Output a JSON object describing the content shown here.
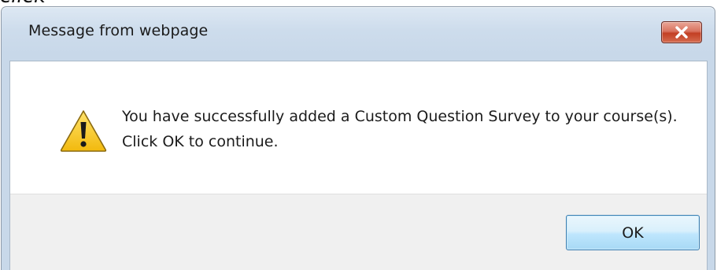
{
  "background": {
    "text": "click"
  },
  "dialog": {
    "title": "Message from webpage",
    "close_icon": "close-icon",
    "warning_icon": "warning-icon",
    "message": "You have successfully added a Custom Question Survey to your course(s). Click OK to continue.",
    "ok_label": "OK"
  },
  "colors": {
    "frame": "#c8d8e9",
    "close_button": "#c23f23",
    "ok_button": "#bee6fd",
    "ok_border": "#3c7fb1",
    "footer": "#f0f0f0"
  }
}
